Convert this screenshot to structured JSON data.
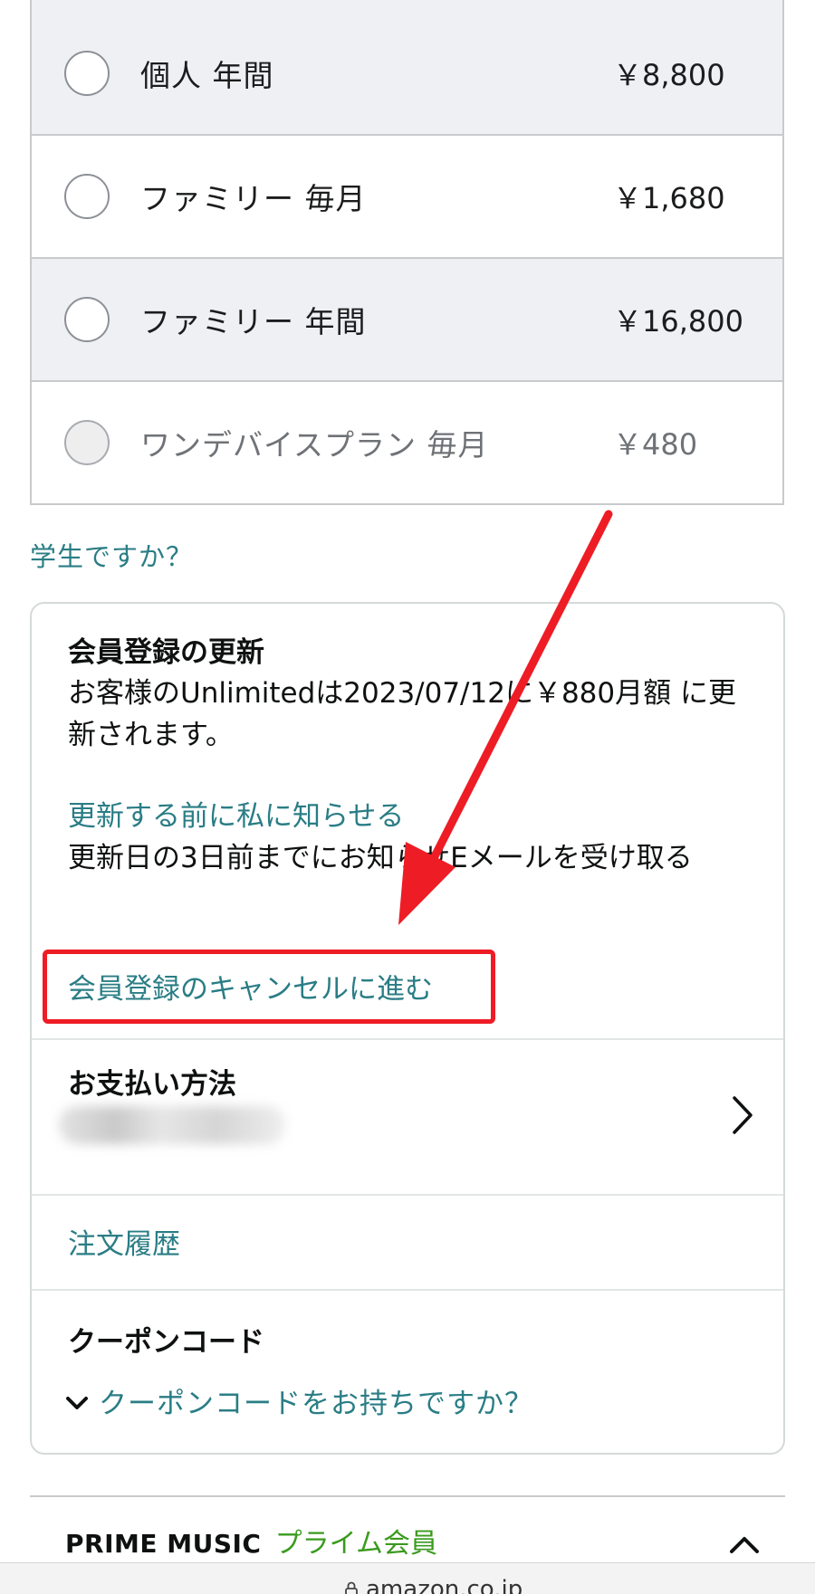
{
  "plans": [
    {
      "name": "個人 年間",
      "price": "￥8,800",
      "selected": false,
      "enabled": true
    },
    {
      "name": "ファミリー 毎月",
      "price": "￥1,680",
      "selected": false,
      "enabled": true
    },
    {
      "name": "ファミリー 年間",
      "price": "￥16,800",
      "selected": false,
      "enabled": true
    },
    {
      "name": "ワンデバイスプラン 毎月",
      "price": "￥480",
      "selected": false,
      "enabled": false
    }
  ],
  "student_link": "学生ですか？",
  "renewal": {
    "title": "会員登録の更新",
    "text": "お客様のUnlimitedは2023/07/12に￥880月額 に更新されます。",
    "notify_link": "更新する前に私に知らせる",
    "notify_text": "更新日の3日前までにお知らせEメールを受け取る",
    "cancel_link": "会員登録のキャンセルに進む"
  },
  "payment": {
    "title": "お支払い方法"
  },
  "order_history_link": "注文履歴",
  "coupon": {
    "title": "クーポンコード",
    "toggle_label": "クーポンコードをお持ちですか？"
  },
  "footer": {
    "prime_music": "PRIME MUSIC",
    "prime_member": "プライム会員"
  },
  "browser": {
    "url": "amazon.co.jp"
  },
  "icons": {
    "radio": "radio-button-icon",
    "chevron_right": "chevron-right-icon",
    "chevron_down": "chevron-down-icon",
    "chevron_up": "chevron-up-icon",
    "lock": "lock-icon",
    "annotation_arrow": "red-arrow-annotation"
  },
  "colors": {
    "link": "#2a7d85",
    "annotation": "#ee1c25",
    "prime": "#3a9a1e",
    "row_alt": "#eff0f3"
  }
}
